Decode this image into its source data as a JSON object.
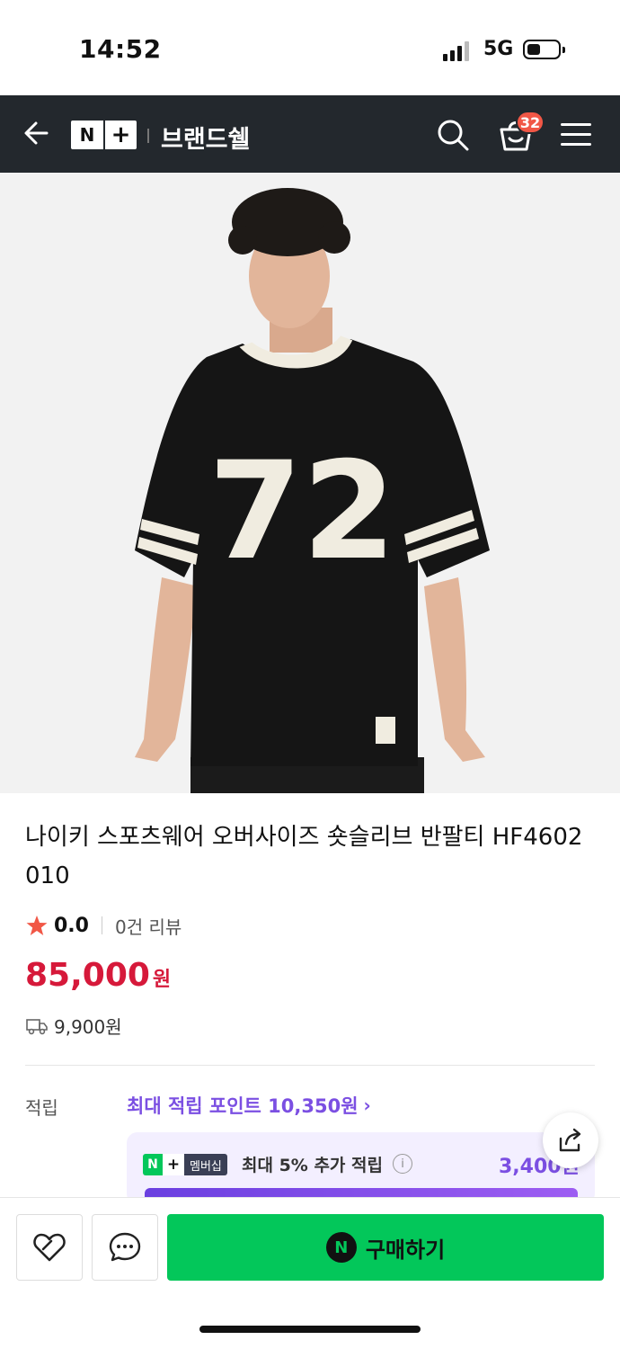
{
  "status_bar": {
    "time": "14:52",
    "network": "5G"
  },
  "header": {
    "logo_n": "N",
    "logo_plus": "+",
    "title": "브랜드쉘",
    "cart_count": "32"
  },
  "product": {
    "title": "나이키 스포츠웨어 오버사이즈 숏슬리브 반팔티 HF4602 010",
    "rating": "0.0",
    "review_count": "0건 리뷰",
    "price": "85,000",
    "price_unit": "원",
    "shipping_fee": "9,900원",
    "jersey_number": "72"
  },
  "points": {
    "label": "적립",
    "max_points": "최대 적립 포인트 10,350원",
    "membership_badge": "멤버십",
    "membership_text": "최대 5% 추가 적립",
    "membership_amount": "3,400원"
  },
  "bottom_bar": {
    "buy_icon": "N",
    "buy_label": "구매하기"
  },
  "colors": {
    "header_bg": "#23282d",
    "price": "#d6193a",
    "accent_purple": "#7b4fe2",
    "buy_green": "#03c75a",
    "badge_red": "#f15746"
  }
}
